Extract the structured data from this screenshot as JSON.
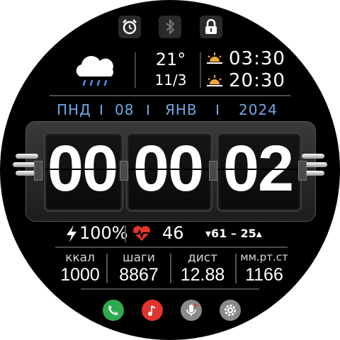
{
  "weather": {
    "temperature": "21°",
    "date_short": "11/3",
    "icon": "rain-cloud-icon"
  },
  "sun": {
    "sunrise": "03:30",
    "sunset": "20:30"
  },
  "date": {
    "weekday": "ПНД",
    "day": "08",
    "month": "ЯНВ",
    "year": "2024"
  },
  "time": {
    "hours": "00",
    "minutes": "00",
    "seconds": "02"
  },
  "stats": {
    "battery": "100%",
    "heart_rate": "46",
    "hr_range": "▾61 – 25▴"
  },
  "metrics": [
    {
      "label": "ккал",
      "value": "1000"
    },
    {
      "label": "шаги",
      "value": "8867"
    },
    {
      "label": "дист",
      "value": "12.88"
    },
    {
      "label": "мм.рт.ст",
      "value": "1166"
    }
  ],
  "colors": {
    "accent": "#6fa8e6",
    "phone": "#2eaa4e",
    "music": "#e0342c",
    "gray": "#8a8a8a",
    "heart": "#e0342c"
  },
  "status_icons": [
    "alarm-icon",
    "bluetooth-icon",
    "lock-icon"
  ],
  "app_icons": [
    "phone-icon",
    "music-icon",
    "microphone-icon",
    "settings-icon"
  ]
}
